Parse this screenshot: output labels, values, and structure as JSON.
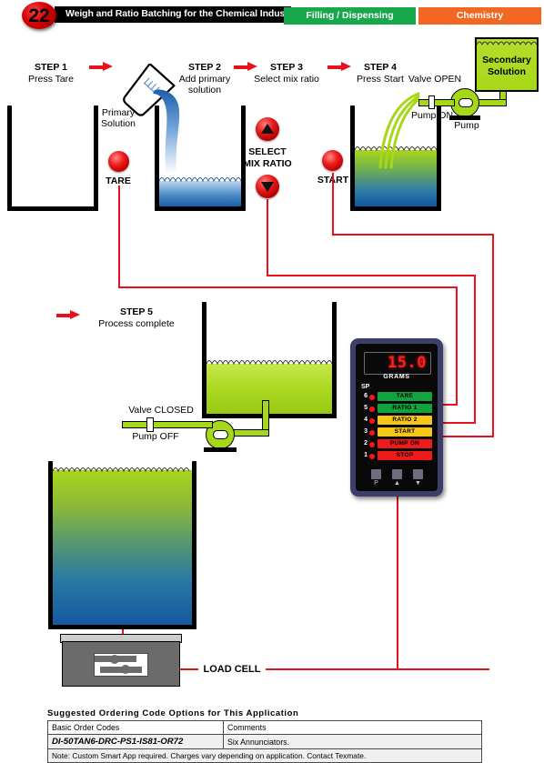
{
  "header": {
    "badge_number": "22",
    "title": "Weigh and Ratio Batching for the Chemical Industry.",
    "tag_green": "Filling / Dispensing",
    "tag_orange": "Chemistry"
  },
  "steps": [
    {
      "id": "step1",
      "title": "STEP 1",
      "detail": "Press Tare"
    },
    {
      "id": "step2",
      "title": "STEP 2",
      "detail_line1": "Add primary",
      "detail_line2": "solution"
    },
    {
      "id": "step3",
      "title": "STEP 3",
      "detail": "Select mix ratio"
    },
    {
      "id": "step4",
      "title": "STEP 4",
      "detail": "Press Start"
    },
    {
      "id": "step5",
      "title": "STEP 5",
      "detail": "Process complete"
    }
  ],
  "labels": {
    "primary_solution_l1": "Primary",
    "primary_solution_l2": "Solution",
    "secondary_solution_l1": "Secondary",
    "secondary_solution_l2": "Solution",
    "tare": "TARE",
    "select_l1": "SELECT",
    "select_l2": "MIX RATIO",
    "start": "START",
    "valve_open": "Valve OPEN",
    "pump_on": "Pump ON",
    "pump": "Pump",
    "valve_closed": "Valve CLOSED",
    "pump_off": "Pump OFF",
    "load_cell": "LOAD CELL"
  },
  "meter": {
    "display_value": "15.0",
    "units": "GRAMS",
    "sp_label": "SP",
    "annunciators": [
      {
        "sp": "6",
        "label": "TARE",
        "bg": "#12a33f",
        "fg": "#000000"
      },
      {
        "sp": "5",
        "label": "RATIO 1",
        "bg": "#12a33f",
        "fg": "#000000"
      },
      {
        "sp": "4",
        "label": "RATIO 2",
        "bg": "#f5c518",
        "fg": "#000000"
      },
      {
        "sp": "3",
        "label": "START",
        "bg": "#f5c518",
        "fg": "#000000"
      },
      {
        "sp": "2",
        "label": "PUMP ON",
        "bg": "#ef1b1b",
        "fg": "#000000"
      },
      {
        "sp": "1",
        "label": "STOP",
        "bg": "#ef1b1b",
        "fg": "#000000"
      }
    ],
    "buttons": [
      {
        "name": "program",
        "glyph": "P"
      },
      {
        "name": "up",
        "glyph": "▲"
      },
      {
        "name": "down",
        "glyph": "▼"
      }
    ]
  },
  "ordering": {
    "title": "Suggested Ordering Code Options for This Application",
    "col_code": "Basic Order Codes",
    "col_comments": "Comments",
    "row_code": "DI-50TAN6-DRC-PS1-IS81-OR72",
    "row_comment": "Six Annunciators.",
    "note": "Note: Custom Smart App required. Charges vary depending on application. Contact Texmate."
  },
  "colors": {
    "green_tag": "#16a84a",
    "orange_tag": "#f26722",
    "red_wire": "#e8101a",
    "pipe_green": "#a6d817",
    "meter_bezel": "#3e3f68",
    "display_red": "#ff1d1d"
  }
}
